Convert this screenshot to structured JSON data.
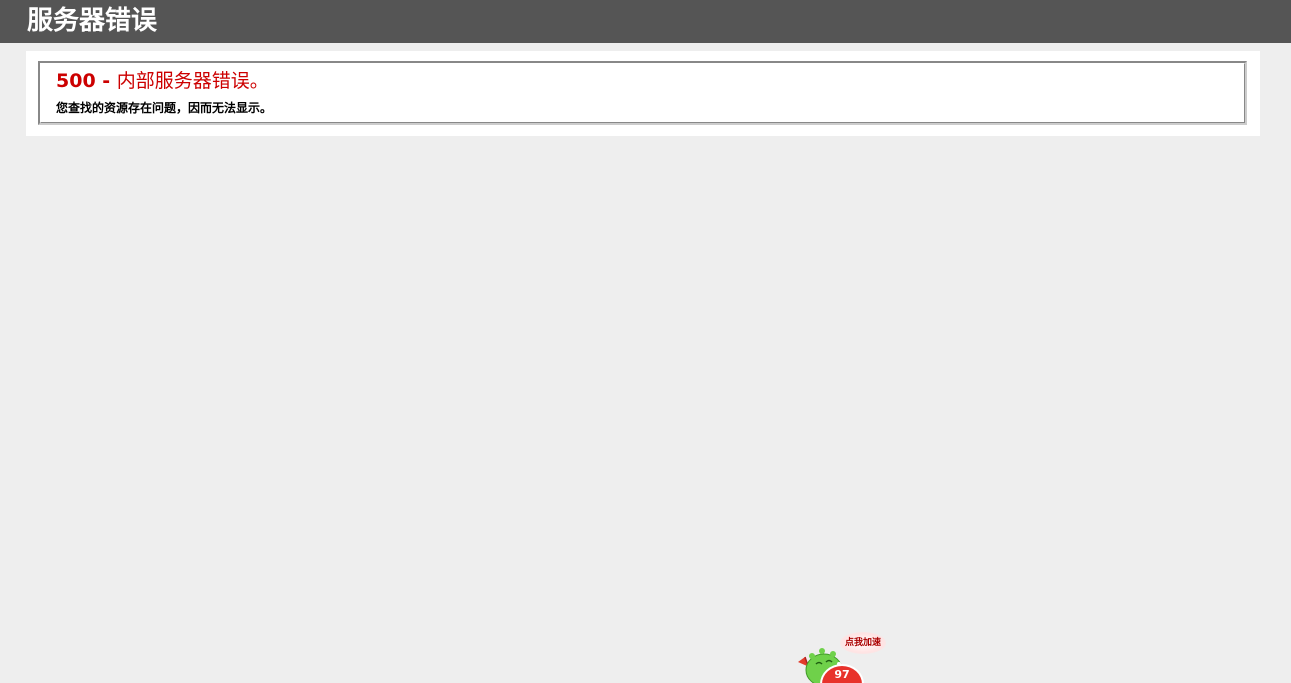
{
  "header": {
    "title": "服务器错误"
  },
  "error": {
    "code": "500 - ",
    "title": "内部服务器错误。",
    "description": "您查找的资源存在问题，因而无法显示。"
  },
  "accelerator_widget": {
    "bubble_label": "点我加速",
    "badge_value": "97"
  },
  "colors": {
    "header_bg": "#555555",
    "page_bg": "#eeeeee",
    "error_red": "#cc0000",
    "badge_red": "#e8322b",
    "mascot_green": "#6fd14a"
  }
}
